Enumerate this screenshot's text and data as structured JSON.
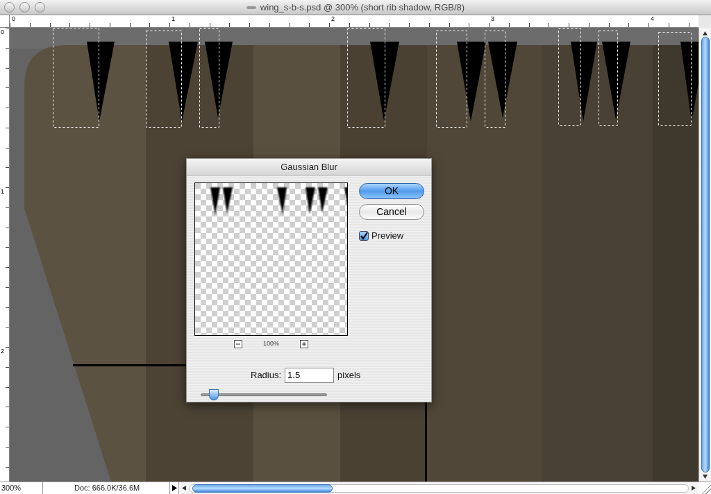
{
  "window": {
    "title": "wing_s-b-s.psd @ 300% (short rib shadow, RGB/8)"
  },
  "rulers": {
    "horizontal": [
      "0",
      "1",
      "2",
      "3",
      "4"
    ],
    "vertical": [
      "0",
      "1",
      "2"
    ]
  },
  "dialog": {
    "title": "Gaussian Blur",
    "zoom": "100%",
    "buttons": [
      {
        "label": "OK",
        "default": true
      },
      {
        "label": "Cancel",
        "default": false
      }
    ],
    "preview": {
      "label": "Preview",
      "checked": true
    },
    "radius": {
      "label": "Radius:",
      "value": "1.5",
      "unit": "pixels",
      "level": 0.07
    }
  },
  "status_bar": {
    "zoom": "300%",
    "doc": "Doc: 666.0K/36.6M"
  }
}
